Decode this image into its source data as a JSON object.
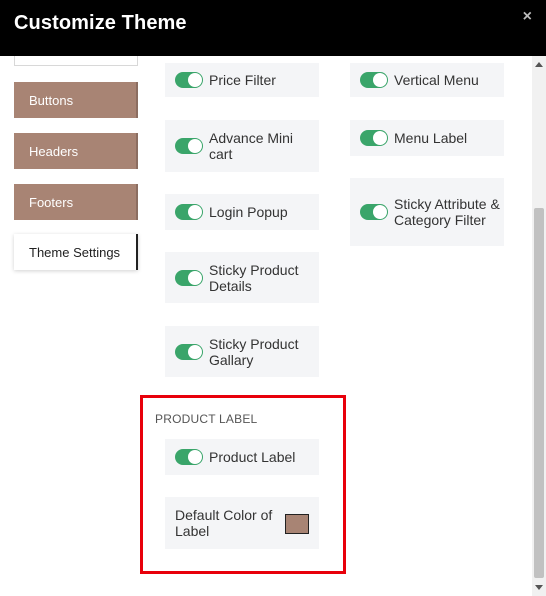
{
  "header": {
    "title": "Customize Theme",
    "close_symbol": "×"
  },
  "sidebar": {
    "items": [
      {
        "label": "Buttons",
        "active": false
      },
      {
        "label": "Headers",
        "active": false
      },
      {
        "label": "Footers",
        "active": false
      },
      {
        "label": "Theme Settings",
        "active": true
      }
    ]
  },
  "settings": {
    "left_column": [
      {
        "label": "Price Filter",
        "enabled": true
      },
      {
        "label": "Advance Mini cart",
        "enabled": true
      },
      {
        "label": "Login Popup",
        "enabled": true
      },
      {
        "label": "Sticky Product Details",
        "enabled": true
      },
      {
        "label": "Sticky Product Gallary",
        "enabled": true
      }
    ],
    "right_column": [
      {
        "label": "Vertical Menu",
        "enabled": true
      },
      {
        "label": "Menu Label",
        "enabled": true
      },
      {
        "label": "Sticky Attribute & Category Filter",
        "enabled": true
      }
    ]
  },
  "product_label_section": {
    "title": "PRODUCT LABEL",
    "toggle": {
      "label": "Product Label",
      "enabled": true
    },
    "color_setting": {
      "label": "Default Color of Label",
      "color": "#a88474"
    }
  },
  "colors": {
    "header_bg": "#000000",
    "sidebar_button": "#a88474",
    "toggle_on": "#3aa56a",
    "card_bg": "#f4f5f7",
    "highlight_border": "#e8000b"
  }
}
